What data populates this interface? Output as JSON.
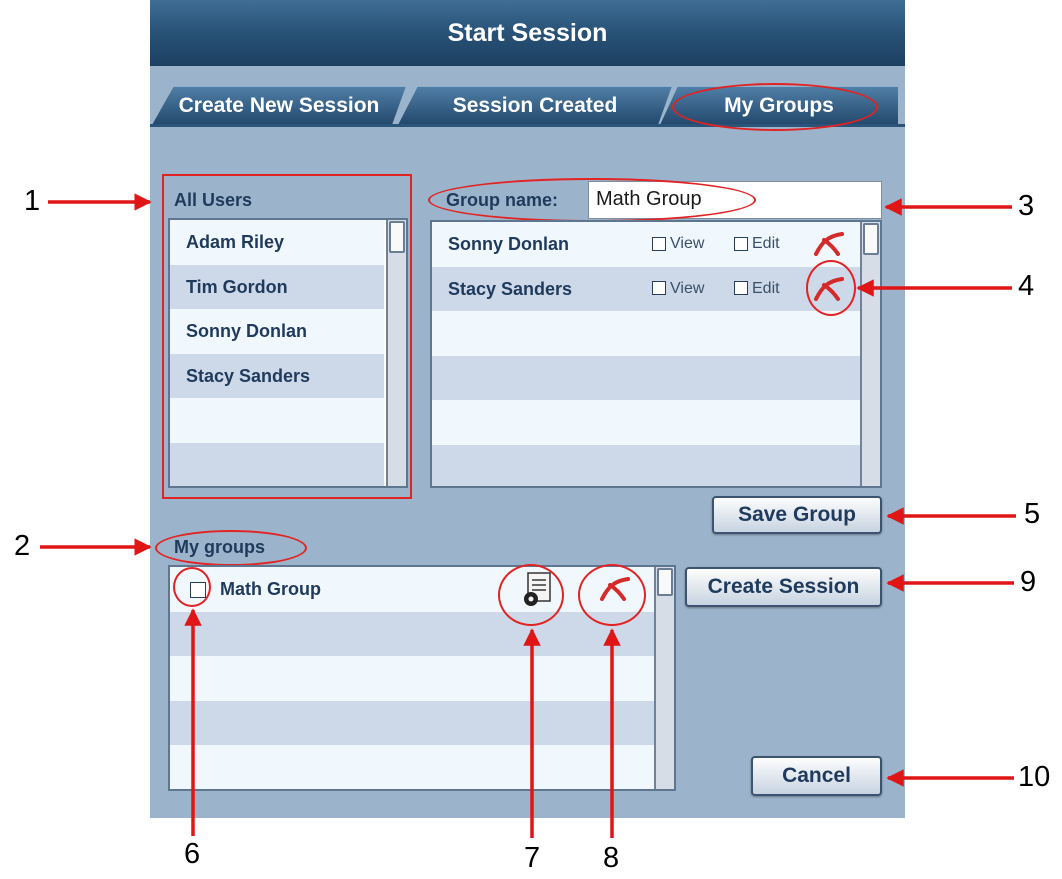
{
  "window": {
    "title": "Start Session"
  },
  "tabs": [
    {
      "label": "Create New Session"
    },
    {
      "label": "Session Created"
    },
    {
      "label": "My Groups"
    }
  ],
  "all_users": {
    "heading": "All Users",
    "items": [
      "Adam Riley",
      "Tim Gordon",
      "Sonny Donlan",
      "Stacy Sanders"
    ]
  },
  "group_editor": {
    "name_label": "Group name:",
    "name_value": "Math Group",
    "members": [
      {
        "name": "Sonny Donlan",
        "view": "View",
        "edit": "Edit"
      },
      {
        "name": "Stacy Sanders",
        "view": "View",
        "edit": "Edit"
      }
    ],
    "save_label": "Save Group"
  },
  "my_groups": {
    "heading": "My groups",
    "items": [
      {
        "name": "Math Group"
      }
    ]
  },
  "buttons": {
    "create_session": "Create Session",
    "cancel": "Cancel"
  },
  "callouts": [
    "1",
    "2",
    "3",
    "4",
    "5",
    "6",
    "7",
    "8",
    "9",
    "10"
  ],
  "colors": {
    "annotation": "#e32222",
    "panel": "#9cb4cb",
    "title_bar": "#2a5479",
    "remove_icon": "#d42a2a"
  }
}
